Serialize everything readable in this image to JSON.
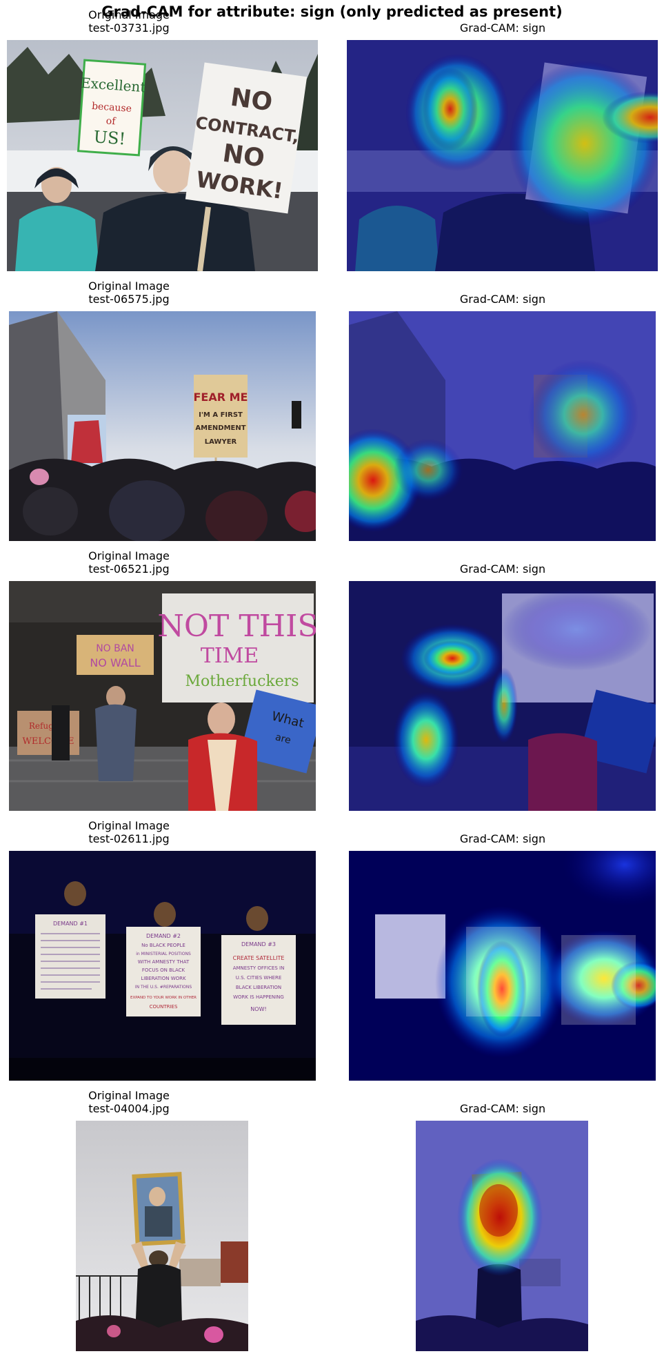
{
  "suptitle": "Grad-CAM for attribute: sign (only predicted as present)",
  "rows": [
    {
      "orig_label": "Original Image",
      "filename": "test-03731.jpg",
      "cam_label": "Grad-CAM: sign"
    },
    {
      "orig_label": "Original Image",
      "filename": "test-06575.jpg",
      "cam_label": "Grad-CAM: sign"
    },
    {
      "orig_label": "Original Image",
      "filename": "test-06521.jpg",
      "cam_label": "Grad-CAM: sign"
    },
    {
      "orig_label": "Original Image",
      "filename": "test-02611.jpg",
      "cam_label": "Grad-CAM: sign"
    },
    {
      "orig_label": "Original Image",
      "filename": "test-04004.jpg",
      "cam_label": "Grad-CAM: sign"
    }
  ],
  "photo_text": {
    "r1_sign_left": [
      "Excellent",
      "because",
      "of",
      "US!"
    ],
    "r1_sign_right": [
      "NO",
      "CONTRACT,",
      "NO",
      "WORK!"
    ],
    "r2_sign": [
      "FEAR ME",
      "I'M A FIRST",
      "AMENDMENT",
      "LAWYER"
    ],
    "r3_sign_big": [
      "NOT THIS",
      "TIME",
      "Motherfuckers"
    ],
    "r3_sign_small": [
      "NO BAN",
      "NO WALL"
    ],
    "r3_sign_left": [
      "Refugees",
      "WELCOME"
    ],
    "r3_sign_right": [
      "What",
      "are"
    ],
    "r4_sign_a": [
      "DEMAND #1"
    ],
    "r4_sign_b": [
      "DEMAND #2",
      "No BLACK PEOPLE",
      "in MINISTERIAL POSITIONS",
      "WITH AMNESTY THAT",
      "FOCUS ON BLACK",
      "LIBERATION WORK",
      "IN THE U.S. #REPARATIONS",
      "EXPAND TO YOUR WORK IN OTHER",
      "COUNTRIES"
    ],
    "r4_sign_c": [
      "DEMAND #3",
      "CREATE SATELLITE",
      "AMNESTY OFFICES IN",
      "U.S. CITIES WHERE",
      "BLACK LIBERATION",
      "WORK IS HAPPENING",
      "NOW!"
    ]
  }
}
